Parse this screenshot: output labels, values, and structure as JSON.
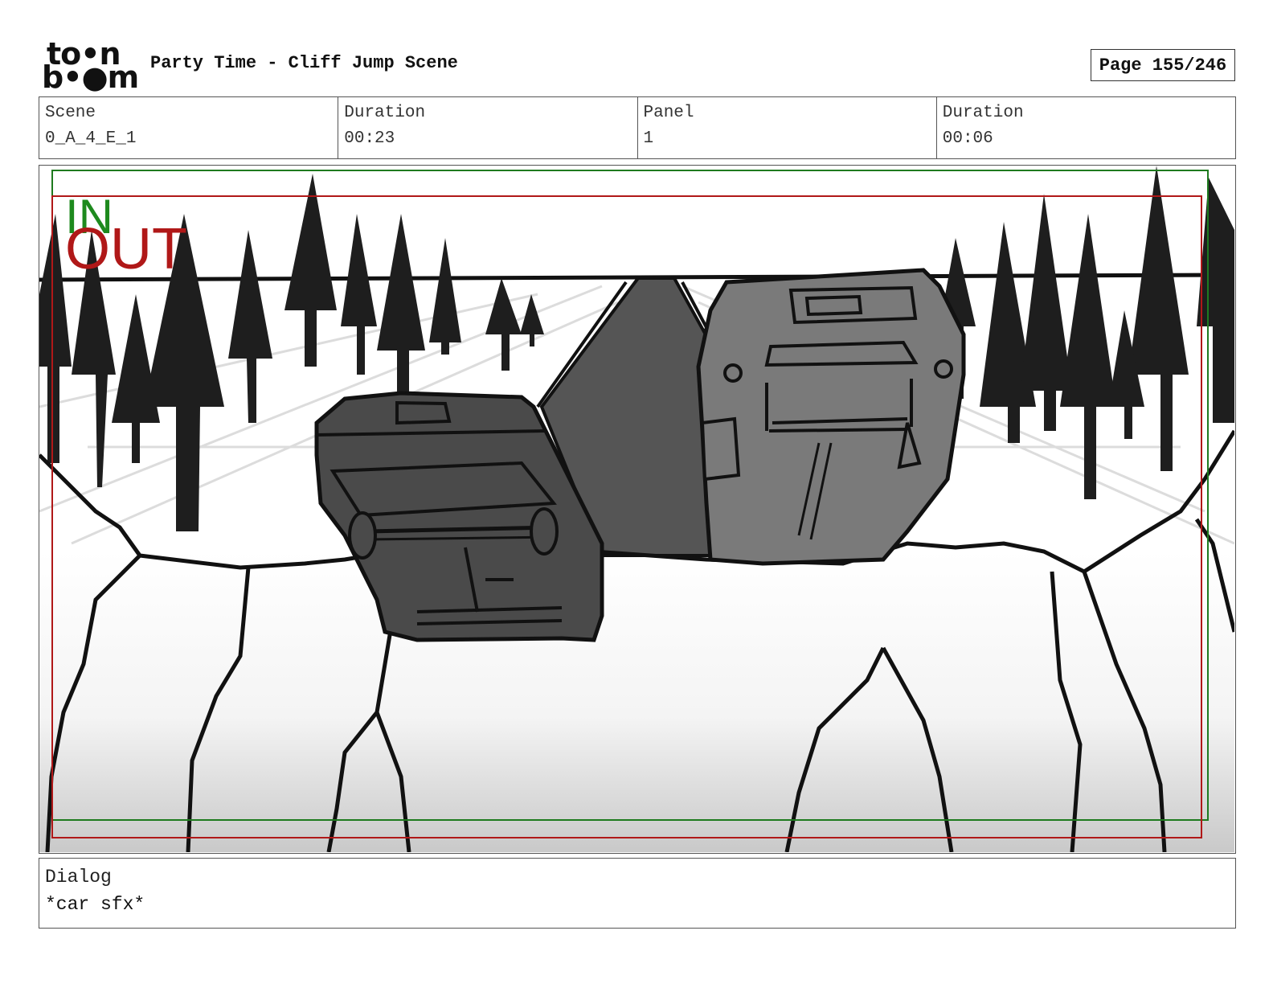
{
  "header": {
    "logo_line1": "to•n",
    "logo_line2": "b•●m",
    "title": "Party Time - Cliff Jump Scene",
    "page": "Page 155/246"
  },
  "info": {
    "scene_label": "Scene",
    "scene_value": "0_A_4_E_1",
    "scene_duration_label": "Duration",
    "scene_duration_value": "00:23",
    "panel_label": "Panel",
    "panel_value": "1",
    "panel_duration_label": "Duration",
    "panel_duration_value": "00:06"
  },
  "panel_image": {
    "in_label": "IN",
    "out_label": "OUT",
    "in_color": "#1e8a1e",
    "out_color": "#b01818"
  },
  "dialog": {
    "label": "Dialog",
    "text": "*car sfx*"
  }
}
